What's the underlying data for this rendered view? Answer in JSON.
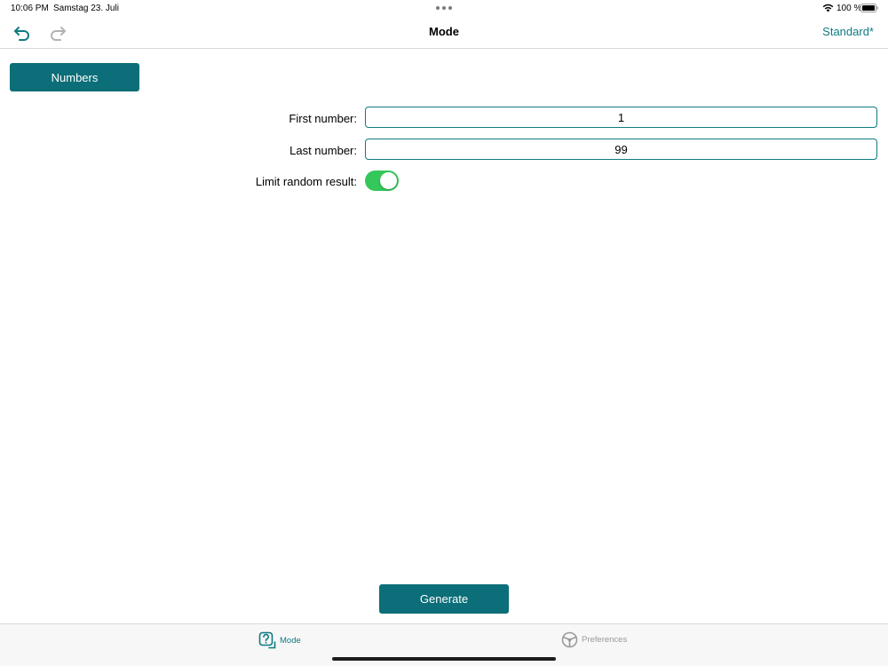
{
  "status_bar": {
    "time": "10:06 PM",
    "date": "Samstag 23. Juli",
    "battery": "100 %"
  },
  "nav": {
    "title": "Mode",
    "right_button": "Standard*"
  },
  "mode_button": "Numbers",
  "form": {
    "first_label": "First number:",
    "first_value": "1",
    "last_label": "Last number:",
    "last_value": "99",
    "limit_label": "Limit random result:",
    "limit_enabled": true
  },
  "generate_button": "Generate",
  "tabs": [
    {
      "label": "Mode",
      "icon": "dice-question-icon",
      "active": true
    },
    {
      "label": "Preferences",
      "icon": "steering-wheel-icon",
      "active": false
    }
  ],
  "colors": {
    "accent": "#0e7a83",
    "button_fill": "#0b6e78",
    "toggle_on": "#34c759",
    "inactive": "#9a9a9a"
  }
}
